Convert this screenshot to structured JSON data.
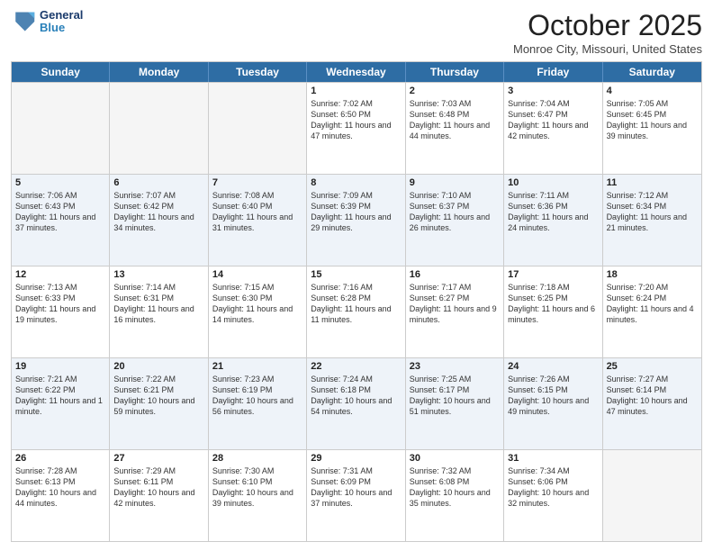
{
  "header": {
    "logo_line1": "General",
    "logo_line2": "Blue",
    "month": "October 2025",
    "location": "Monroe City, Missouri, United States"
  },
  "days_of_week": [
    "Sunday",
    "Monday",
    "Tuesday",
    "Wednesday",
    "Thursday",
    "Friday",
    "Saturday"
  ],
  "rows": [
    [
      {
        "day": "",
        "info": ""
      },
      {
        "day": "",
        "info": ""
      },
      {
        "day": "",
        "info": ""
      },
      {
        "day": "1",
        "info": "Sunrise: 7:02 AM\nSunset: 6:50 PM\nDaylight: 11 hours and 47 minutes."
      },
      {
        "day": "2",
        "info": "Sunrise: 7:03 AM\nSunset: 6:48 PM\nDaylight: 11 hours and 44 minutes."
      },
      {
        "day": "3",
        "info": "Sunrise: 7:04 AM\nSunset: 6:47 PM\nDaylight: 11 hours and 42 minutes."
      },
      {
        "day": "4",
        "info": "Sunrise: 7:05 AM\nSunset: 6:45 PM\nDaylight: 11 hours and 39 minutes."
      }
    ],
    [
      {
        "day": "5",
        "info": "Sunrise: 7:06 AM\nSunset: 6:43 PM\nDaylight: 11 hours and 37 minutes."
      },
      {
        "day": "6",
        "info": "Sunrise: 7:07 AM\nSunset: 6:42 PM\nDaylight: 11 hours and 34 minutes."
      },
      {
        "day": "7",
        "info": "Sunrise: 7:08 AM\nSunset: 6:40 PM\nDaylight: 11 hours and 31 minutes."
      },
      {
        "day": "8",
        "info": "Sunrise: 7:09 AM\nSunset: 6:39 PM\nDaylight: 11 hours and 29 minutes."
      },
      {
        "day": "9",
        "info": "Sunrise: 7:10 AM\nSunset: 6:37 PM\nDaylight: 11 hours and 26 minutes."
      },
      {
        "day": "10",
        "info": "Sunrise: 7:11 AM\nSunset: 6:36 PM\nDaylight: 11 hours and 24 minutes."
      },
      {
        "day": "11",
        "info": "Sunrise: 7:12 AM\nSunset: 6:34 PM\nDaylight: 11 hours and 21 minutes."
      }
    ],
    [
      {
        "day": "12",
        "info": "Sunrise: 7:13 AM\nSunset: 6:33 PM\nDaylight: 11 hours and 19 minutes."
      },
      {
        "day": "13",
        "info": "Sunrise: 7:14 AM\nSunset: 6:31 PM\nDaylight: 11 hours and 16 minutes."
      },
      {
        "day": "14",
        "info": "Sunrise: 7:15 AM\nSunset: 6:30 PM\nDaylight: 11 hours and 14 minutes."
      },
      {
        "day": "15",
        "info": "Sunrise: 7:16 AM\nSunset: 6:28 PM\nDaylight: 11 hours and 11 minutes."
      },
      {
        "day": "16",
        "info": "Sunrise: 7:17 AM\nSunset: 6:27 PM\nDaylight: 11 hours and 9 minutes."
      },
      {
        "day": "17",
        "info": "Sunrise: 7:18 AM\nSunset: 6:25 PM\nDaylight: 11 hours and 6 minutes."
      },
      {
        "day": "18",
        "info": "Sunrise: 7:20 AM\nSunset: 6:24 PM\nDaylight: 11 hours and 4 minutes."
      }
    ],
    [
      {
        "day": "19",
        "info": "Sunrise: 7:21 AM\nSunset: 6:22 PM\nDaylight: 11 hours and 1 minute."
      },
      {
        "day": "20",
        "info": "Sunrise: 7:22 AM\nSunset: 6:21 PM\nDaylight: 10 hours and 59 minutes."
      },
      {
        "day": "21",
        "info": "Sunrise: 7:23 AM\nSunset: 6:19 PM\nDaylight: 10 hours and 56 minutes."
      },
      {
        "day": "22",
        "info": "Sunrise: 7:24 AM\nSunset: 6:18 PM\nDaylight: 10 hours and 54 minutes."
      },
      {
        "day": "23",
        "info": "Sunrise: 7:25 AM\nSunset: 6:17 PM\nDaylight: 10 hours and 51 minutes."
      },
      {
        "day": "24",
        "info": "Sunrise: 7:26 AM\nSunset: 6:15 PM\nDaylight: 10 hours and 49 minutes."
      },
      {
        "day": "25",
        "info": "Sunrise: 7:27 AM\nSunset: 6:14 PM\nDaylight: 10 hours and 47 minutes."
      }
    ],
    [
      {
        "day": "26",
        "info": "Sunrise: 7:28 AM\nSunset: 6:13 PM\nDaylight: 10 hours and 44 minutes."
      },
      {
        "day": "27",
        "info": "Sunrise: 7:29 AM\nSunset: 6:11 PM\nDaylight: 10 hours and 42 minutes."
      },
      {
        "day": "28",
        "info": "Sunrise: 7:30 AM\nSunset: 6:10 PM\nDaylight: 10 hours and 39 minutes."
      },
      {
        "day": "29",
        "info": "Sunrise: 7:31 AM\nSunset: 6:09 PM\nDaylight: 10 hours and 37 minutes."
      },
      {
        "day": "30",
        "info": "Sunrise: 7:32 AM\nSunset: 6:08 PM\nDaylight: 10 hours and 35 minutes."
      },
      {
        "day": "31",
        "info": "Sunrise: 7:34 AM\nSunset: 6:06 PM\nDaylight: 10 hours and 32 minutes."
      },
      {
        "day": "",
        "info": ""
      }
    ]
  ]
}
